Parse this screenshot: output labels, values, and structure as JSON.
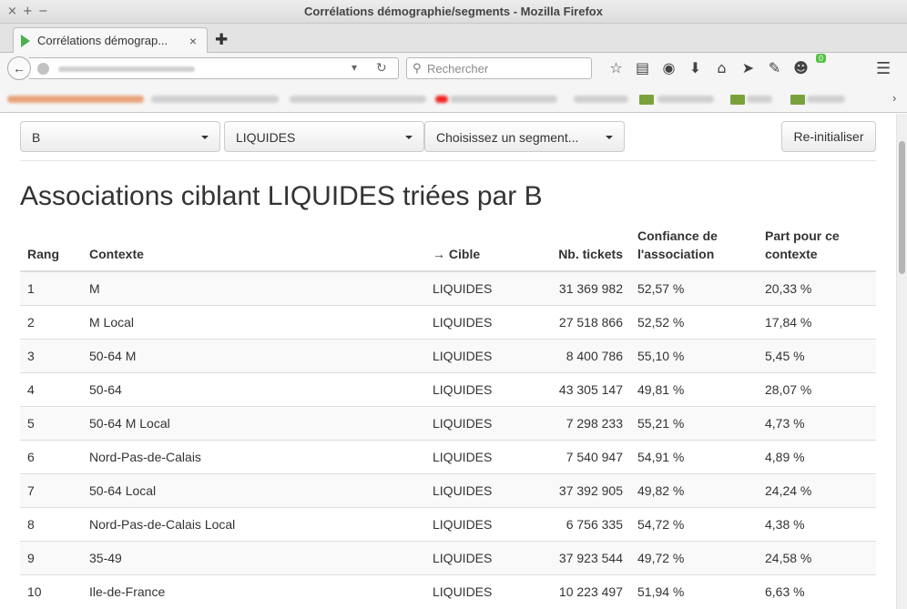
{
  "window": {
    "title": "Corrélations démographie/segments - Mozilla Firefox",
    "controls": [
      "×",
      "+",
      "−"
    ]
  },
  "tab": {
    "label": "Corrélations démograp...",
    "close": "×",
    "new_tab": "✚"
  },
  "navbar": {
    "search_placeholder": "Rechercher",
    "icons": [
      "star-icon",
      "reading-list-icon",
      "pocket-icon",
      "download-icon",
      "home-icon",
      "send-icon",
      "extension-icon",
      "emoji-icon",
      "menu-icon"
    ],
    "badge": "0"
  },
  "filters": {
    "sort_select": "B",
    "target_select": "LIQUIDES",
    "segment_select": "Choisissez un segment...",
    "reset_label": "Re-initialiser"
  },
  "heading": "Associations ciblant LIQUIDES triées par B",
  "table": {
    "headers": {
      "rank": "Rang",
      "context": "Contexte",
      "target": "→ Cible",
      "tickets": "Nb. tickets",
      "confidence_1": "Confiance de",
      "confidence_2": "l'association",
      "share_1": "Part pour ce",
      "share_2": "contexte"
    },
    "rows": [
      {
        "rank": "1",
        "context": "M",
        "target": "LIQUIDES",
        "tickets": "31 369 982",
        "confidence": "52,57 %",
        "share": "20,33 %"
      },
      {
        "rank": "2",
        "context": "M Local",
        "target": "LIQUIDES",
        "tickets": "27 518 866",
        "confidence": "52,52 %",
        "share": "17,84 %"
      },
      {
        "rank": "3",
        "context": "50-64 M",
        "target": "LIQUIDES",
        "tickets": "8 400 786",
        "confidence": "55,10 %",
        "share": "5,45 %"
      },
      {
        "rank": "4",
        "context": "50-64",
        "target": "LIQUIDES",
        "tickets": "43 305 147",
        "confidence": "49,81 %",
        "share": "28,07 %"
      },
      {
        "rank": "5",
        "context": "50-64 M Local",
        "target": "LIQUIDES",
        "tickets": "7 298 233",
        "confidence": "55,21 %",
        "share": "4,73 %"
      },
      {
        "rank": "6",
        "context": "Nord-Pas-de-Calais",
        "target": "LIQUIDES",
        "tickets": "7 540 947",
        "confidence": "54,91 %",
        "share": "4,89 %"
      },
      {
        "rank": "7",
        "context": "50-64 Local",
        "target": "LIQUIDES",
        "tickets": "37 392 905",
        "confidence": "49,82 %",
        "share": "24,24 %"
      },
      {
        "rank": "8",
        "context": "Nord-Pas-de-Calais Local",
        "target": "LIQUIDES",
        "tickets": "6 756 335",
        "confidence": "54,72 %",
        "share": "4,38 %"
      },
      {
        "rank": "9",
        "context": "35-49",
        "target": "LIQUIDES",
        "tickets": "37 923 544",
        "confidence": "49,72 %",
        "share": "24,58 %"
      },
      {
        "rank": "10",
        "context": "Ile-de-France",
        "target": "LIQUIDES",
        "tickets": "10 223 497",
        "confidence": "51,94 %",
        "share": "6,63 %"
      }
    ]
  }
}
